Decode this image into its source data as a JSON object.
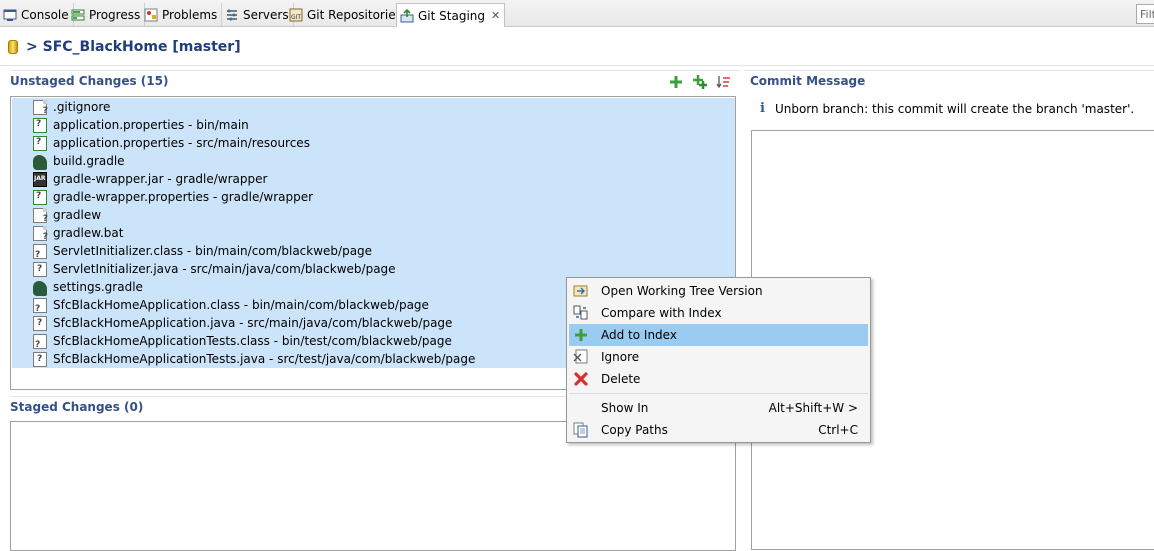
{
  "tabs": [
    {
      "label": "Console",
      "icon": "console-icon"
    },
    {
      "label": "Progress",
      "icon": "progress-icon"
    },
    {
      "label": "Problems",
      "icon": "problems-icon"
    },
    {
      "label": "Servers",
      "icon": "servers-icon"
    },
    {
      "label": "Git Repositories",
      "icon": "git-repositories-icon"
    },
    {
      "label": "Git Staging",
      "icon": "git-staging-icon",
      "active": true
    }
  ],
  "filter_text": "Filt",
  "repo_title": "> SFC_BlackHome [master]",
  "unstaged": {
    "title": "Unstaged Changes (15)",
    "files": [
      {
        "label": ".gitignore",
        "icon": "text-file-icon"
      },
      {
        "label": "application.properties - bin/main",
        "icon": "properties-file-icon"
      },
      {
        "label": "application.properties - src/main/resources",
        "icon": "properties-file-icon"
      },
      {
        "label": "build.gradle",
        "icon": "gradle-icon"
      },
      {
        "label": "gradle-wrapper.jar - gradle/wrapper",
        "icon": "jar-file-icon"
      },
      {
        "label": "gradle-wrapper.properties - gradle/wrapper",
        "icon": "properties-file-icon"
      },
      {
        "label": "gradlew",
        "icon": "text-file-icon"
      },
      {
        "label": "gradlew.bat",
        "icon": "batch-file-icon"
      },
      {
        "label": "ServletInitializer.class - bin/main/com/blackweb/page",
        "icon": "class-file-icon"
      },
      {
        "label": "ServletInitializer.java - src/main/java/com/blackweb/page",
        "icon": "java-file-icon"
      },
      {
        "label": "settings.gradle",
        "icon": "gradle-icon"
      },
      {
        "label": "SfcBlackHomeApplication.class - bin/main/com/blackweb/page",
        "icon": "class-file-icon"
      },
      {
        "label": "SfcBlackHomeApplication.java - src/main/java/com/blackweb/page",
        "icon": "java-file-icon"
      },
      {
        "label": "SfcBlackHomeApplicationTests.class - bin/test/com/blackweb/page",
        "icon": "class-file-icon"
      },
      {
        "label": "SfcBlackHomeApplicationTests.java - src/test/java/com/blackweb/page",
        "icon": "java-file-icon"
      }
    ]
  },
  "staged": {
    "title": "Staged Changes (0)"
  },
  "commit": {
    "title": "Commit Message",
    "info": "Unborn branch: this commit will create the branch 'master'."
  },
  "context_menu": {
    "items": [
      {
        "label": "Open Working Tree Version",
        "icon": "open-working-tree-icon",
        "shortcut": ""
      },
      {
        "label": "Compare with Index",
        "icon": "compare-icon",
        "shortcut": ""
      },
      {
        "label": "Add to Index",
        "icon": "add-icon",
        "shortcut": "",
        "highlighted": true
      },
      {
        "label": "Ignore",
        "icon": "ignore-icon",
        "shortcut": ""
      },
      {
        "label": "Delete",
        "icon": "delete-icon",
        "shortcut": ""
      },
      {
        "label": "Show In",
        "icon": "",
        "shortcut": "Alt+Shift+W >"
      },
      {
        "label": "Copy Paths",
        "icon": "copy-paths-icon",
        "shortcut": "Ctrl+C"
      }
    ]
  }
}
